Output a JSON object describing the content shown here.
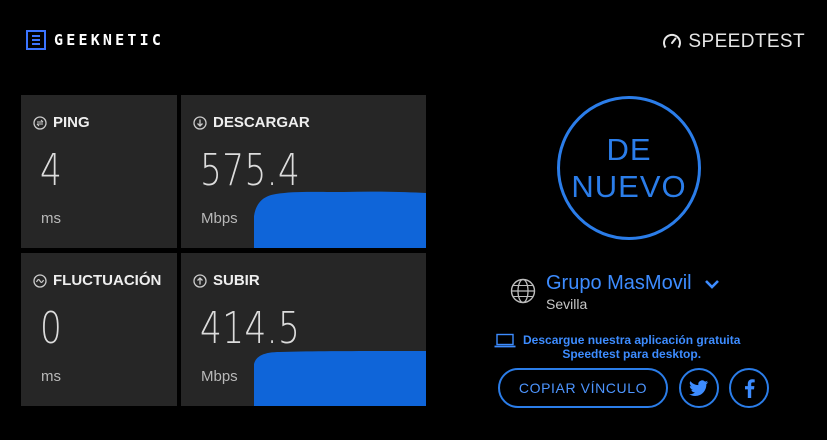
{
  "header": {
    "brand": "GEEKNETIC",
    "speedtest_logo": "SPEEDTEST"
  },
  "tiles": {
    "ping": {
      "label": "PING",
      "value": "4",
      "unit": "ms",
      "icon": "ping-icon"
    },
    "download": {
      "label": "DESCARGAR",
      "value": "575.4",
      "unit": "Mbps",
      "icon": "download-arrow-icon"
    },
    "jitter": {
      "label": "FLUCTUACIÓN",
      "value": "0",
      "unit": "ms",
      "icon": "jitter-icon"
    },
    "upload": {
      "label": "SUBIR",
      "value": "414.5",
      "unit": "Mbps",
      "icon": "upload-arrow-icon"
    }
  },
  "go_button": {
    "line1": "DE",
    "line2": "NUEVO"
  },
  "provider": {
    "name": "Grupo MasMovil",
    "location": "Sevilla"
  },
  "app_promo": {
    "line1": "Descargue nuestra aplicación gratuita",
    "line2": "Speedtest para desktop."
  },
  "share": {
    "copy_link": "COPIAR VÍNCULO",
    "twitter_icon": "twitter-icon",
    "facebook_icon": "facebook-icon"
  },
  "colors": {
    "accent": "#2b7de9",
    "graph_fill": "#0f65d9",
    "tile_bg": "#262626",
    "background": "#000000"
  }
}
